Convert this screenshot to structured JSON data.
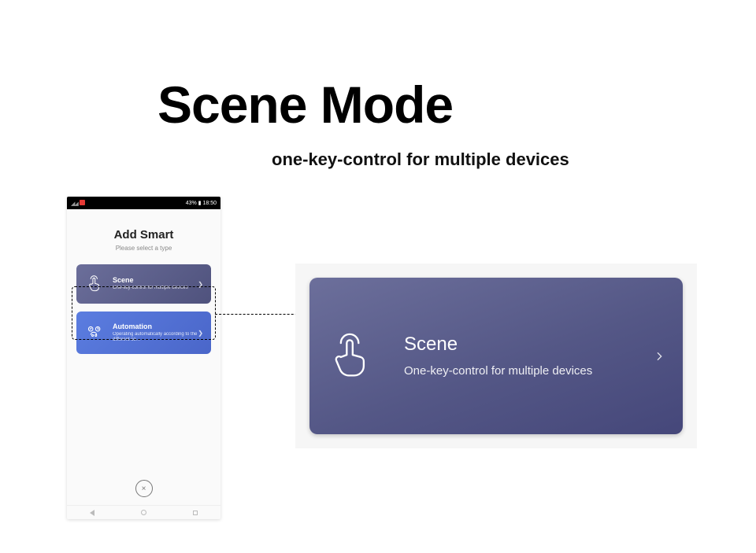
{
  "header": {
    "title": "Scene Mode",
    "subtitle": "one-key-control for multiple devices"
  },
  "phone": {
    "statusbar": {
      "left_signal_glyphs": "▫ ▫ ◢ ◢",
      "battery_text": "43%",
      "time": "18:50"
    },
    "title": "Add Smart",
    "subtitle": "Please select a type",
    "cards": [
      {
        "label": "Scene",
        "desc": "One-key-control for multiple devices"
      },
      {
        "label": "Automation",
        "desc": "Operating automatically according to the different co…"
      }
    ],
    "close_glyph": "×",
    "nav": {
      "back": "◁",
      "home": "○",
      "recent": "□"
    }
  },
  "detail_card": {
    "title": "Scene",
    "desc": "One-key-control for multiple devices"
  }
}
